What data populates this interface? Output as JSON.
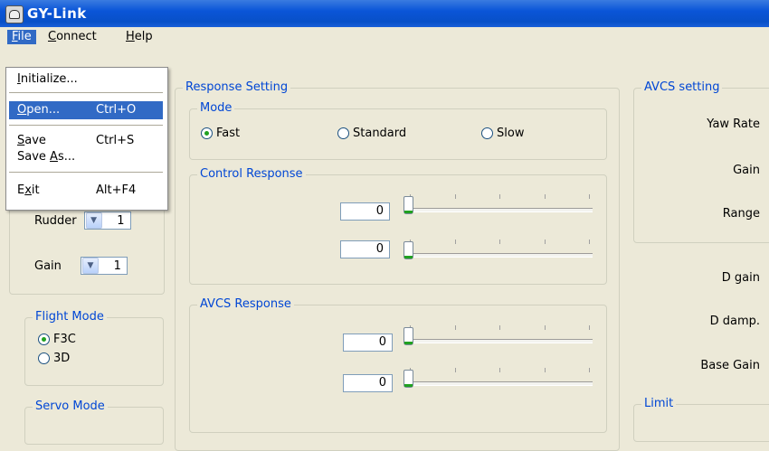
{
  "window": {
    "title": "GY-Link",
    "icon": "app-icon"
  },
  "menubar": {
    "file": {
      "pre": "",
      "acc": "F",
      "post": "ile"
    },
    "connect": {
      "pre": "",
      "acc": "C",
      "post": "onnect"
    },
    "help": {
      "pre": "",
      "acc": "H",
      "post": "elp"
    }
  },
  "file_menu": {
    "initialize": {
      "pre": "",
      "acc": "I",
      "post": "nitialize...",
      "shortcut": ""
    },
    "open": {
      "pre": "",
      "acc": "O",
      "post": "pen...",
      "shortcut": "Ctrl+O"
    },
    "save": {
      "pre": "",
      "acc": "S",
      "post": "ave",
      "shortcut": "Ctrl+S"
    },
    "save_as": {
      "pre": "Save ",
      "acc": "A",
      "post": "s...",
      "shortcut": ""
    },
    "exit": {
      "pre": "E",
      "acc": "x",
      "post": "it",
      "shortcut": "Alt+F4"
    }
  },
  "left": {
    "rudder": {
      "label": "Rudder",
      "value": "1"
    },
    "gain": {
      "label": "Gain",
      "value": "1"
    },
    "flight_mode": {
      "title": "Flight Mode",
      "options": [
        "F3C",
        "3D"
      ],
      "selected": "F3C"
    },
    "servo_mode": {
      "title": "Servo Mode"
    }
  },
  "response_setting": {
    "title": "Response Setting",
    "mode": {
      "title": "Mode",
      "options": [
        "Fast",
        "Standard",
        "Slow"
      ],
      "selected": "Fast"
    },
    "control_response": {
      "title": "Control Response",
      "values": [
        "0",
        "0"
      ]
    },
    "avcs_response": {
      "title": "AVCS Response",
      "values": [
        "0",
        "0"
      ]
    }
  },
  "avcs_setting": {
    "title": "AVCS setting",
    "labels": [
      "Yaw Rate",
      "Gain",
      "Range"
    ],
    "lower_labels": [
      "D gain",
      "D damp.",
      "Base Gain"
    ],
    "limit_title": "Limit"
  }
}
